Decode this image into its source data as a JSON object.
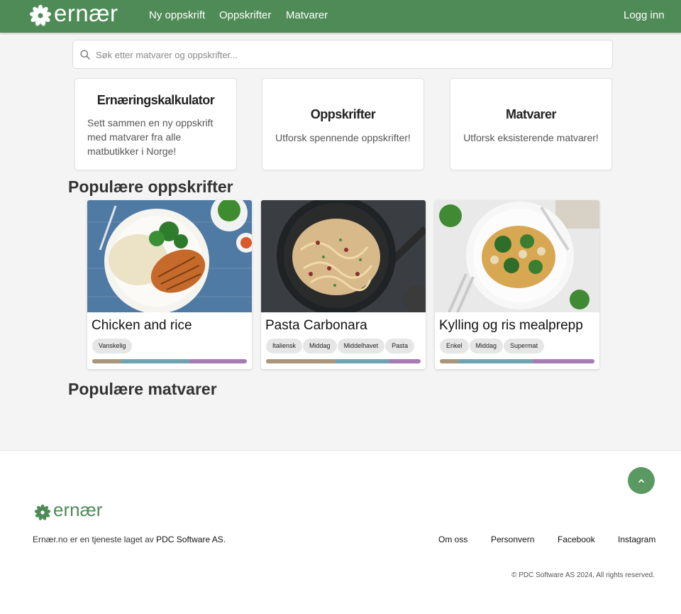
{
  "nav": {
    "logo_text": "ernær",
    "links": [
      "Ny oppskrift",
      "Oppskrifter",
      "Matvarer"
    ],
    "login": "Logg inn"
  },
  "search": {
    "placeholder": "Søk etter matvarer og oppskrifter..."
  },
  "features": [
    {
      "title": "Ernæringskalkulator",
      "text": "Sett sammen en ny oppskrift med matvarer fra alle matbutikker i Norge!"
    },
    {
      "title": "Oppskrifter",
      "text": "Utforsk spennende oppskrifter!"
    },
    {
      "title": "Matvarer",
      "text": "Utforsk eksisterende matvarer!"
    }
  ],
  "sections": {
    "popular_recipes": "Populære oppskrifter",
    "popular_foods": "Populære matvarer"
  },
  "recipes": [
    {
      "title": "Chicken and rice",
      "tags": [
        "Vanskelig"
      ],
      "nutrition": [
        0.19,
        0.44,
        0.37
      ]
    },
    {
      "title": "Pasta Carbonara",
      "tags": [
        "Italiensk",
        "Middag",
        "Middelhavet",
        "Pasta"
      ],
      "nutrition": [
        0.45,
        0.35,
        0.2
      ]
    },
    {
      "title": "Kylling og ris mealprepp",
      "tags": [
        "Enkel",
        "Middag",
        "Supermat"
      ],
      "nutrition": [
        0.12,
        0.48,
        0.4
      ]
    }
  ],
  "nutrition_colors": [
    "#a8957a",
    "#6fa3b0",
    "#a67ab4"
  ],
  "footer": {
    "logo_text": "ernær",
    "made_by_prefix": "Ernær.no er en tjeneste laget av ",
    "made_by_link": "PDC Software AS",
    "made_by_suffix": ".",
    "links": [
      "Om oss",
      "Personvern",
      "Facebook",
      "Instagram"
    ],
    "copyright": "© PDC Software AS 2024, All rights reserved."
  },
  "colors": {
    "brand": "#4e8b56",
    "scroll_button": "#5a9a62"
  },
  "icons": {
    "logo": "flower-icon",
    "search": "search-icon",
    "scroll_top": "chevron-up-icon"
  }
}
